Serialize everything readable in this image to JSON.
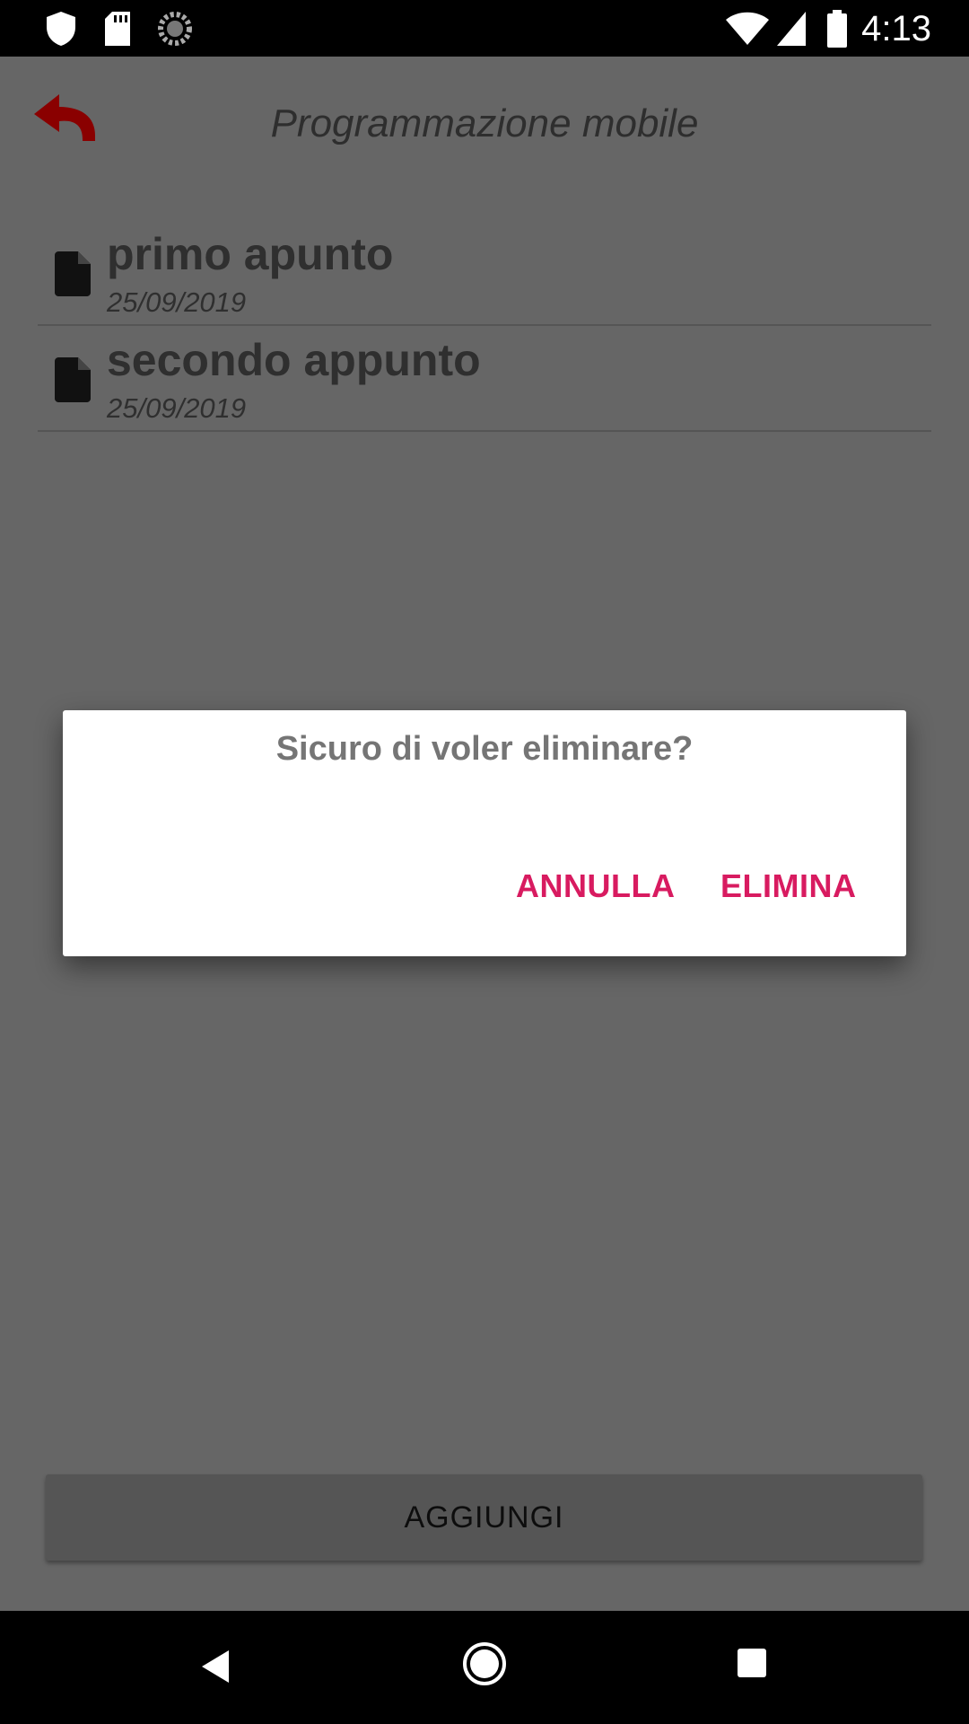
{
  "status_bar": {
    "time": "4:13",
    "icons": [
      "shield-icon",
      "sd-card-icon",
      "sync-icon",
      "wifi-icon",
      "cell-signal-icon",
      "battery-icon"
    ]
  },
  "app_bar": {
    "title": "Programmazione mobile",
    "back_icon": "back-arrow-icon",
    "back_color": "#c40000"
  },
  "notes": [
    {
      "title": "primo apunto",
      "date": "25/09/2019",
      "icon": "file-icon"
    },
    {
      "title": "secondo appunto",
      "date": "25/09/2019",
      "icon": "file-icon"
    }
  ],
  "add_button": {
    "label": "AGGIUNGI"
  },
  "dialog": {
    "message": "Sicuro di voler eliminare?",
    "cancel_label": "ANNULLA",
    "confirm_label": "ELIMINA",
    "accent_color": "#d81b60"
  },
  "nav_bar": {
    "icons": [
      "back-triangle-icon",
      "home-circle-icon",
      "recents-square-icon"
    ]
  }
}
